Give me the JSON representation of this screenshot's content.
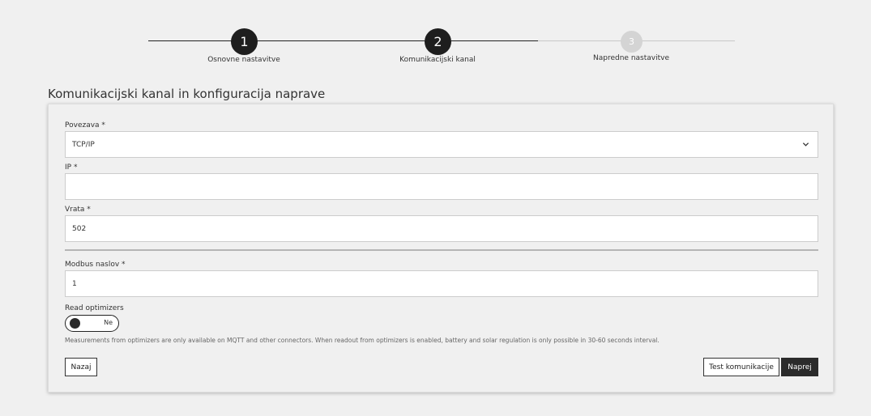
{
  "stepper": {
    "steps": [
      {
        "number": "1",
        "label": "Osnovne nastavitve",
        "state": "completed"
      },
      {
        "number": "2",
        "label": "Komunikacijski kanal",
        "state": "active"
      },
      {
        "number": "3",
        "label": "Napredne nastavitve",
        "state": "inactive"
      }
    ]
  },
  "section": {
    "title": "Komunikacijski kanal in konfiguracija naprave"
  },
  "form": {
    "connection": {
      "label": "Povezava *",
      "value": "TCP/IP"
    },
    "ip": {
      "label": "IP *",
      "value": ""
    },
    "port": {
      "label": "Vrata *",
      "value": "502"
    },
    "modbus": {
      "label": "Modbus naslov *",
      "value": "1"
    },
    "optimizers": {
      "label": "Read optimizers",
      "toggle_text": "Ne",
      "note": "Measurements from optimizers are only available on MQTT and other connectors. When readout from optimizers is enabled, battery and solar regulation is only possible in 30-60 seconds interval."
    }
  },
  "buttons": {
    "back": "Nazaj",
    "test": "Test komunikacije",
    "next": "Naprej"
  },
  "colors": {
    "background": "#f0f0f0",
    "accent_dark": "#1e1e1e",
    "inactive_step": "#d4d4d4"
  }
}
